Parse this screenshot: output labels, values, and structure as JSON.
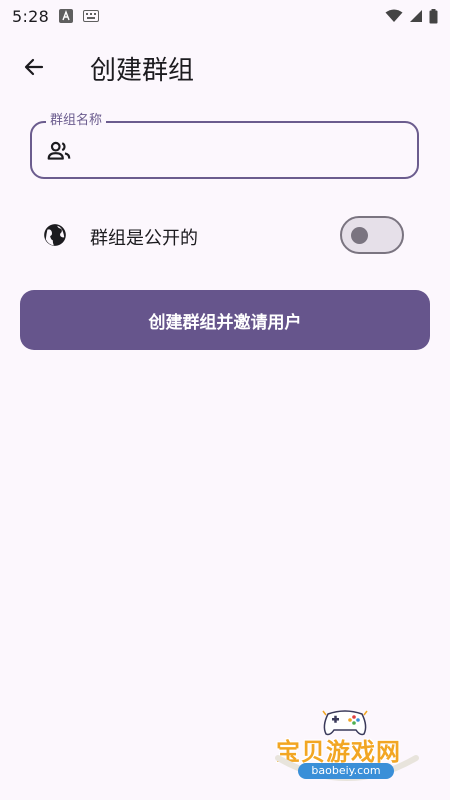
{
  "status_bar": {
    "time": "5:28",
    "icons": [
      "android-icon",
      "keyboard-icon",
      "wifi-icon",
      "signal-icon",
      "battery-icon"
    ]
  },
  "app_bar": {
    "title": "创建群组",
    "back_icon": "arrow-back-icon"
  },
  "group_name_field": {
    "label": "群组名称",
    "value": "",
    "placeholder": "",
    "icon": "group-icon"
  },
  "public_setting": {
    "label": "群组是公开的",
    "icon": "globe-icon",
    "enabled": false
  },
  "create_button": {
    "label": "创建群组并邀请用户"
  },
  "watermark": {
    "text": "宝贝游戏网",
    "url": "baobeiy.com"
  },
  "colors": {
    "background": "#fcf7fd",
    "primary": "#66558c",
    "outline": "#6b5c8e",
    "toggle_outline": "#7a7480",
    "watermark_orange": "#f2a623",
    "watermark_blue": "#3a8fd8"
  }
}
